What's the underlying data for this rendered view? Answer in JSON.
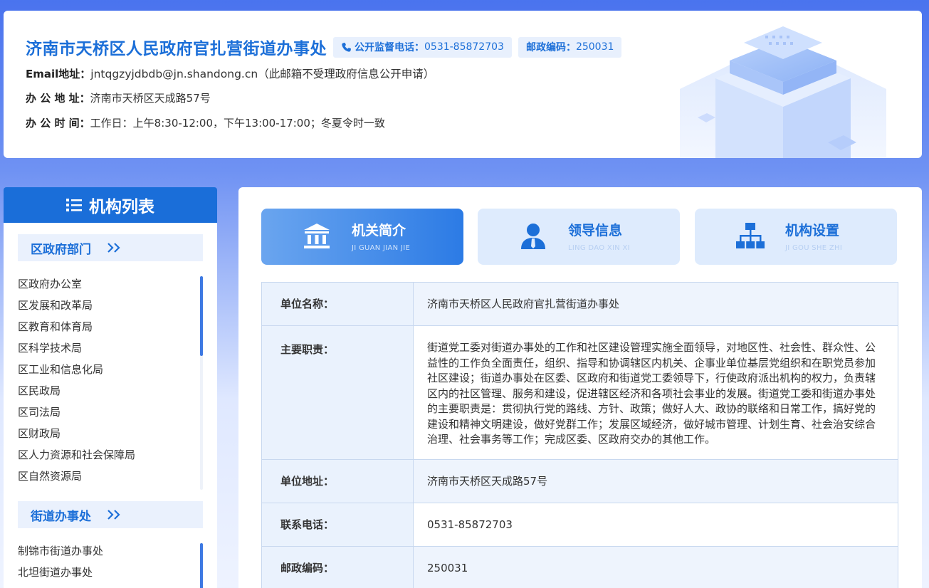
{
  "header": {
    "title": "济南市天桥区人民政府官扎营街道办事处",
    "phone_label": "公开监督电话：",
    "phone_value": "0531-85872703",
    "zip_label": "邮政编码：",
    "zip_value": "250031",
    "email_label": "Email地址：",
    "email_value": "jntqgzyjdbdb@jn.shandong.cn（此邮箱不受理政府信息公开申请）",
    "address_label": "办 公 地 址：",
    "address_value": "济南市天桥区天成路57号",
    "hours_label": "办 公 时 间：",
    "hours_value": "工作日：上午8:30-12:00，下午13:00-17:00；冬夏令时一致"
  },
  "sidebar": {
    "title": "机构列表",
    "section1": {
      "title": "区政府部门",
      "items": [
        "区政府办公室",
        "区发展和改革局",
        "区教育和体育局",
        "区科学技术局",
        "区工业和信息化局",
        "区民政局",
        "区司法局",
        "区财政局",
        "区人力资源和社会保障局",
        "区自然资源局"
      ]
    },
    "section2": {
      "title": "街道办事处",
      "items": [
        "制锦市街道办事处",
        "北坦街道办事处"
      ]
    }
  },
  "tabs": [
    {
      "name": "机关简介",
      "sub": "JI GUAN JIAN JIE",
      "icon": "institution-icon",
      "active": true
    },
    {
      "name": "领导信息",
      "sub": "LING DAO XIN XI",
      "icon": "leader-icon",
      "active": false
    },
    {
      "name": "机构设置",
      "sub": "JI GOU SHE ZHI",
      "icon": "org-chart-icon",
      "active": false
    }
  ],
  "info": {
    "unit_name_label": "单位名称：",
    "unit_name_value": "济南市天桥区人民政府官扎营街道办事处",
    "duty_label": "主要职责：",
    "duty_value": "街道党工委对街道办事处的工作和社区建设管理实施全面领导，对地区性、社会性、群众性、公益性的工作负全面责任，组织、指导和协调辖区内机关、企事业单位基层党组织和在职党员参加社区建设；街道办事处在区委、区政府和街道党工委领导下，行使政府派出机构的权力，负责辖区内的社区管理、服务和建设，促进辖区经济和各项社会事业的发展。街道党工委和街道办事处的主要职责是：贯彻执行党的路线、方针、政策；做好人大、政协的联络和日常工作，搞好党的建设和精神文明建设，做好党群工作；发展区域经济，做好城市管理、计划生育、社会治安综合治理、社会事务等工作；完成区委、区政府交办的其他工作。",
    "address_label": "单位地址：",
    "address_value": "济南市天桥区天成路57号",
    "phone_label": "联系电话：",
    "phone_value": "0531-85872703",
    "zip_label": "邮政编码：",
    "zip_value": "250031"
  },
  "colors": {
    "accent": "#1c6fd8",
    "sidebar_head": "#1a6ed9",
    "tab_inactive": "#deebfd"
  }
}
